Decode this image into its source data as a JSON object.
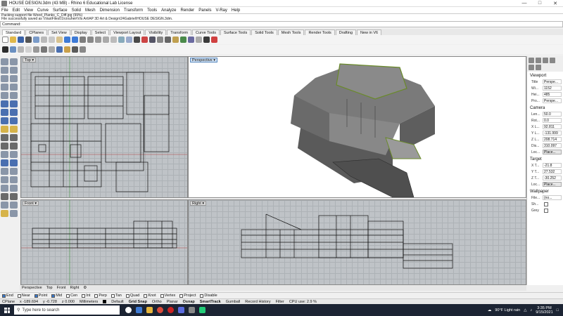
{
  "window": {
    "title": "HOUSE DESIGN.3dm (43 MB) - Rhino 6 Educational Lab License"
  },
  "menu": [
    "File",
    "Edit",
    "View",
    "Curve",
    "Surface",
    "Solid",
    "Mesh",
    "Dimension",
    "Transform",
    "Tools",
    "Analyze",
    "Render",
    "Panels",
    "V-Ray",
    "Help"
  ],
  "command_history": [
    "Packing support file Wood_Planks_C_Diff.jpg (99%)",
    "File successfully saved as \\\\VastFiles01\\rzouheir\\Vis Art\\AP 3D Art & Design\\24Gabriel\\HOUSE DESIGN.3dm."
  ],
  "command_prompt": "Command:",
  "tabs": [
    "Standard",
    "CPlanes",
    "Set View",
    "Display",
    "Select",
    "Viewport Layout",
    "Visibility",
    "Transform",
    "Curve Tools",
    "Surface Tools",
    "Solid Tools",
    "Mesh Tools",
    "Render Tools",
    "Drafting",
    "New in V6"
  ],
  "viewports": {
    "top": "Top",
    "perspective": "Perspective",
    "front": "Front",
    "right": "Right"
  },
  "viewport_tabs": [
    "Perspective",
    "Top",
    "Front",
    "Right"
  ],
  "osnaps": [
    {
      "label": "End",
      "on": true
    },
    {
      "label": "Near",
      "on": false
    },
    {
      "label": "Point",
      "on": true
    },
    {
      "label": "Mid",
      "on": true
    },
    {
      "label": "Cen",
      "on": false
    },
    {
      "label": "Int",
      "on": false
    },
    {
      "label": "Perp",
      "on": false
    },
    {
      "label": "Tan",
      "on": false
    },
    {
      "label": "Quad",
      "on": false
    },
    {
      "label": "Knot",
      "on": false
    },
    {
      "label": "Vertex",
      "on": false
    },
    {
      "label": "Project",
      "on": false
    },
    {
      "label": "Disable",
      "on": false
    }
  ],
  "status": {
    "cplane": "CPlane",
    "x": "x -189.694",
    "y": "y -0.728",
    "z": "z 0.000",
    "units": "Millimeters",
    "layer": "Default",
    "grid_snap": "Grid Snap",
    "ortho": "Ortho",
    "planar": "Planar",
    "osnap": "Osnap",
    "smarttrack": "SmartTrack",
    "gumball": "Gumball",
    "record": "Record History",
    "filter": "Filter",
    "cpu": "CPU use: 2.9 %"
  },
  "properties": {
    "viewport_header": "Viewport",
    "title_label": "Title",
    "title_value": "Perspe...",
    "width_label": "Wi...",
    "width_value": "1152",
    "height_label": "Hei...",
    "height_value": "485",
    "proj_label": "Pro...",
    "proj_value": "Perspe...",
    "camera_header": "Camera",
    "lens_label": "Len...",
    "lens_value": "50.0",
    "rot_label": "Rot...",
    "rot_value": "0.0",
    "xloc_label": "X L...",
    "xloc_value": "92.811",
    "yloc_label": "Y L...",
    "yloc_value": "-131.999",
    "zloc_label": "Z L...",
    "zloc_value": "208.714",
    "dist_label": "Dis...",
    "dist_value": "310.097",
    "loc_label": "Loc...",
    "loc_btn": "Place...",
    "target_header": "Target",
    "xt_label": "X T...",
    "xt_value": "-21.8",
    "yt_label": "Y T...",
    "yt_value": "27.532",
    "zt_label": "Z T...",
    "zt_value": "-30.252",
    "tloc_label": "Loc...",
    "tloc_btn": "Place...",
    "wallpaper_header": "Wallpaper",
    "file_label": "File...",
    "file_value": "(no...",
    "show_label": "Sh...",
    "grey_label": "Grey"
  },
  "taskbar": {
    "search_placeholder": "Type here to search",
    "weather": "90°F  Light rain",
    "time": "3:35 PM",
    "date": "9/15/2021"
  }
}
